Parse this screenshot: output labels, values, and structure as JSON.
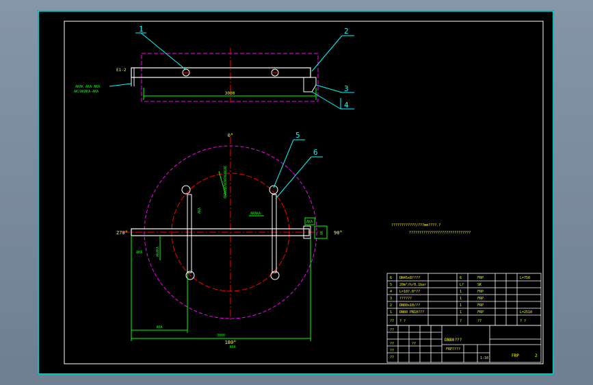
{
  "colors": {
    "background": "#7d8da0",
    "sheet": "#000000",
    "frame": "#00ffff",
    "outline": "#ffffff",
    "centerline": "#ff0000",
    "hidden": "#ff00ff",
    "dimension": "#00ff00",
    "leader": "#00ffff",
    "text": "#ffff00"
  },
  "callouts": [
    "1",
    "2",
    "3",
    "4",
    "5",
    "6"
  ],
  "top_view": {
    "left_label": "Ε1-2",
    "note_line1": "ΑΚΑΚ ΑΚΑ ΑΚΑ",
    "note_line2": "ΑΚ/ΑΚΑΚΑ-ΑΚΑ",
    "span_dim": "3000"
  },
  "plan_view": {
    "angle_top": "0°",
    "angle_left": "270°",
    "angle_right": "90°",
    "angle_bottom": "180°",
    "dim_vertical_label": "ΑΚΑΚΑΚΑΚΑΚΑΚΑΚΑΚ",
    "dim_arm": "ΑΚΑ",
    "dim_center": "ΑΚΑΚΑ",
    "dim_left_tick": "ΑΚΑ",
    "dim_left_vertical": "ΑΚΑΚΑ",
    "dim_right_a": "ΑΚΑ",
    "dim_right_b": "ΑΚ",
    "dim_sub": "ΑΚΑ",
    "dim_bottom_total": "3000",
    "dim_bottom_small": "ΑΚΑ"
  },
  "notes": {
    "line1": "????????????/???mm????.?",
    "line2": "??????????????????????????????"
  },
  "parts_table": {
    "rows": [
      {
        "no": "6",
        "name": "DN45x8????",
        "qty": "6",
        "material": "FRP",
        "remark": "L=750"
      },
      {
        "no": "5",
        "name": "20m³/h/0.1bar",
        "qty": "L?",
        "material": "SK",
        "remark": ""
      },
      {
        "no": "4",
        "name": "L=10?.0*??",
        "qty": "1",
        "material": "FRP",
        "remark": ""
      },
      {
        "no": "3",
        "name": "??????",
        "qty": "1",
        "material": "FRP",
        "remark": ""
      },
      {
        "no": "2",
        "name": "DN80x10/??",
        "qty": "1",
        "material": "FRP",
        "remark": ""
      },
      {
        "no": "1",
        "name": "DN80 PN10???",
        "qty": "1",
        "material": "FRP",
        "remark": "L=2510"
      }
    ],
    "header": {
      "no": "??",
      "name": "?   ?",
      "qty": "?",
      "material": "??",
      "remark": "?  ?"
    }
  },
  "title_block": {
    "drawing_title": "DN80???",
    "code": "FRP????",
    "scale": "1:10",
    "material": "FRP",
    "sheet": "2",
    "left_cells": [
      "??",
      "??",
      "??",
      "??",
      "??"
    ]
  }
}
